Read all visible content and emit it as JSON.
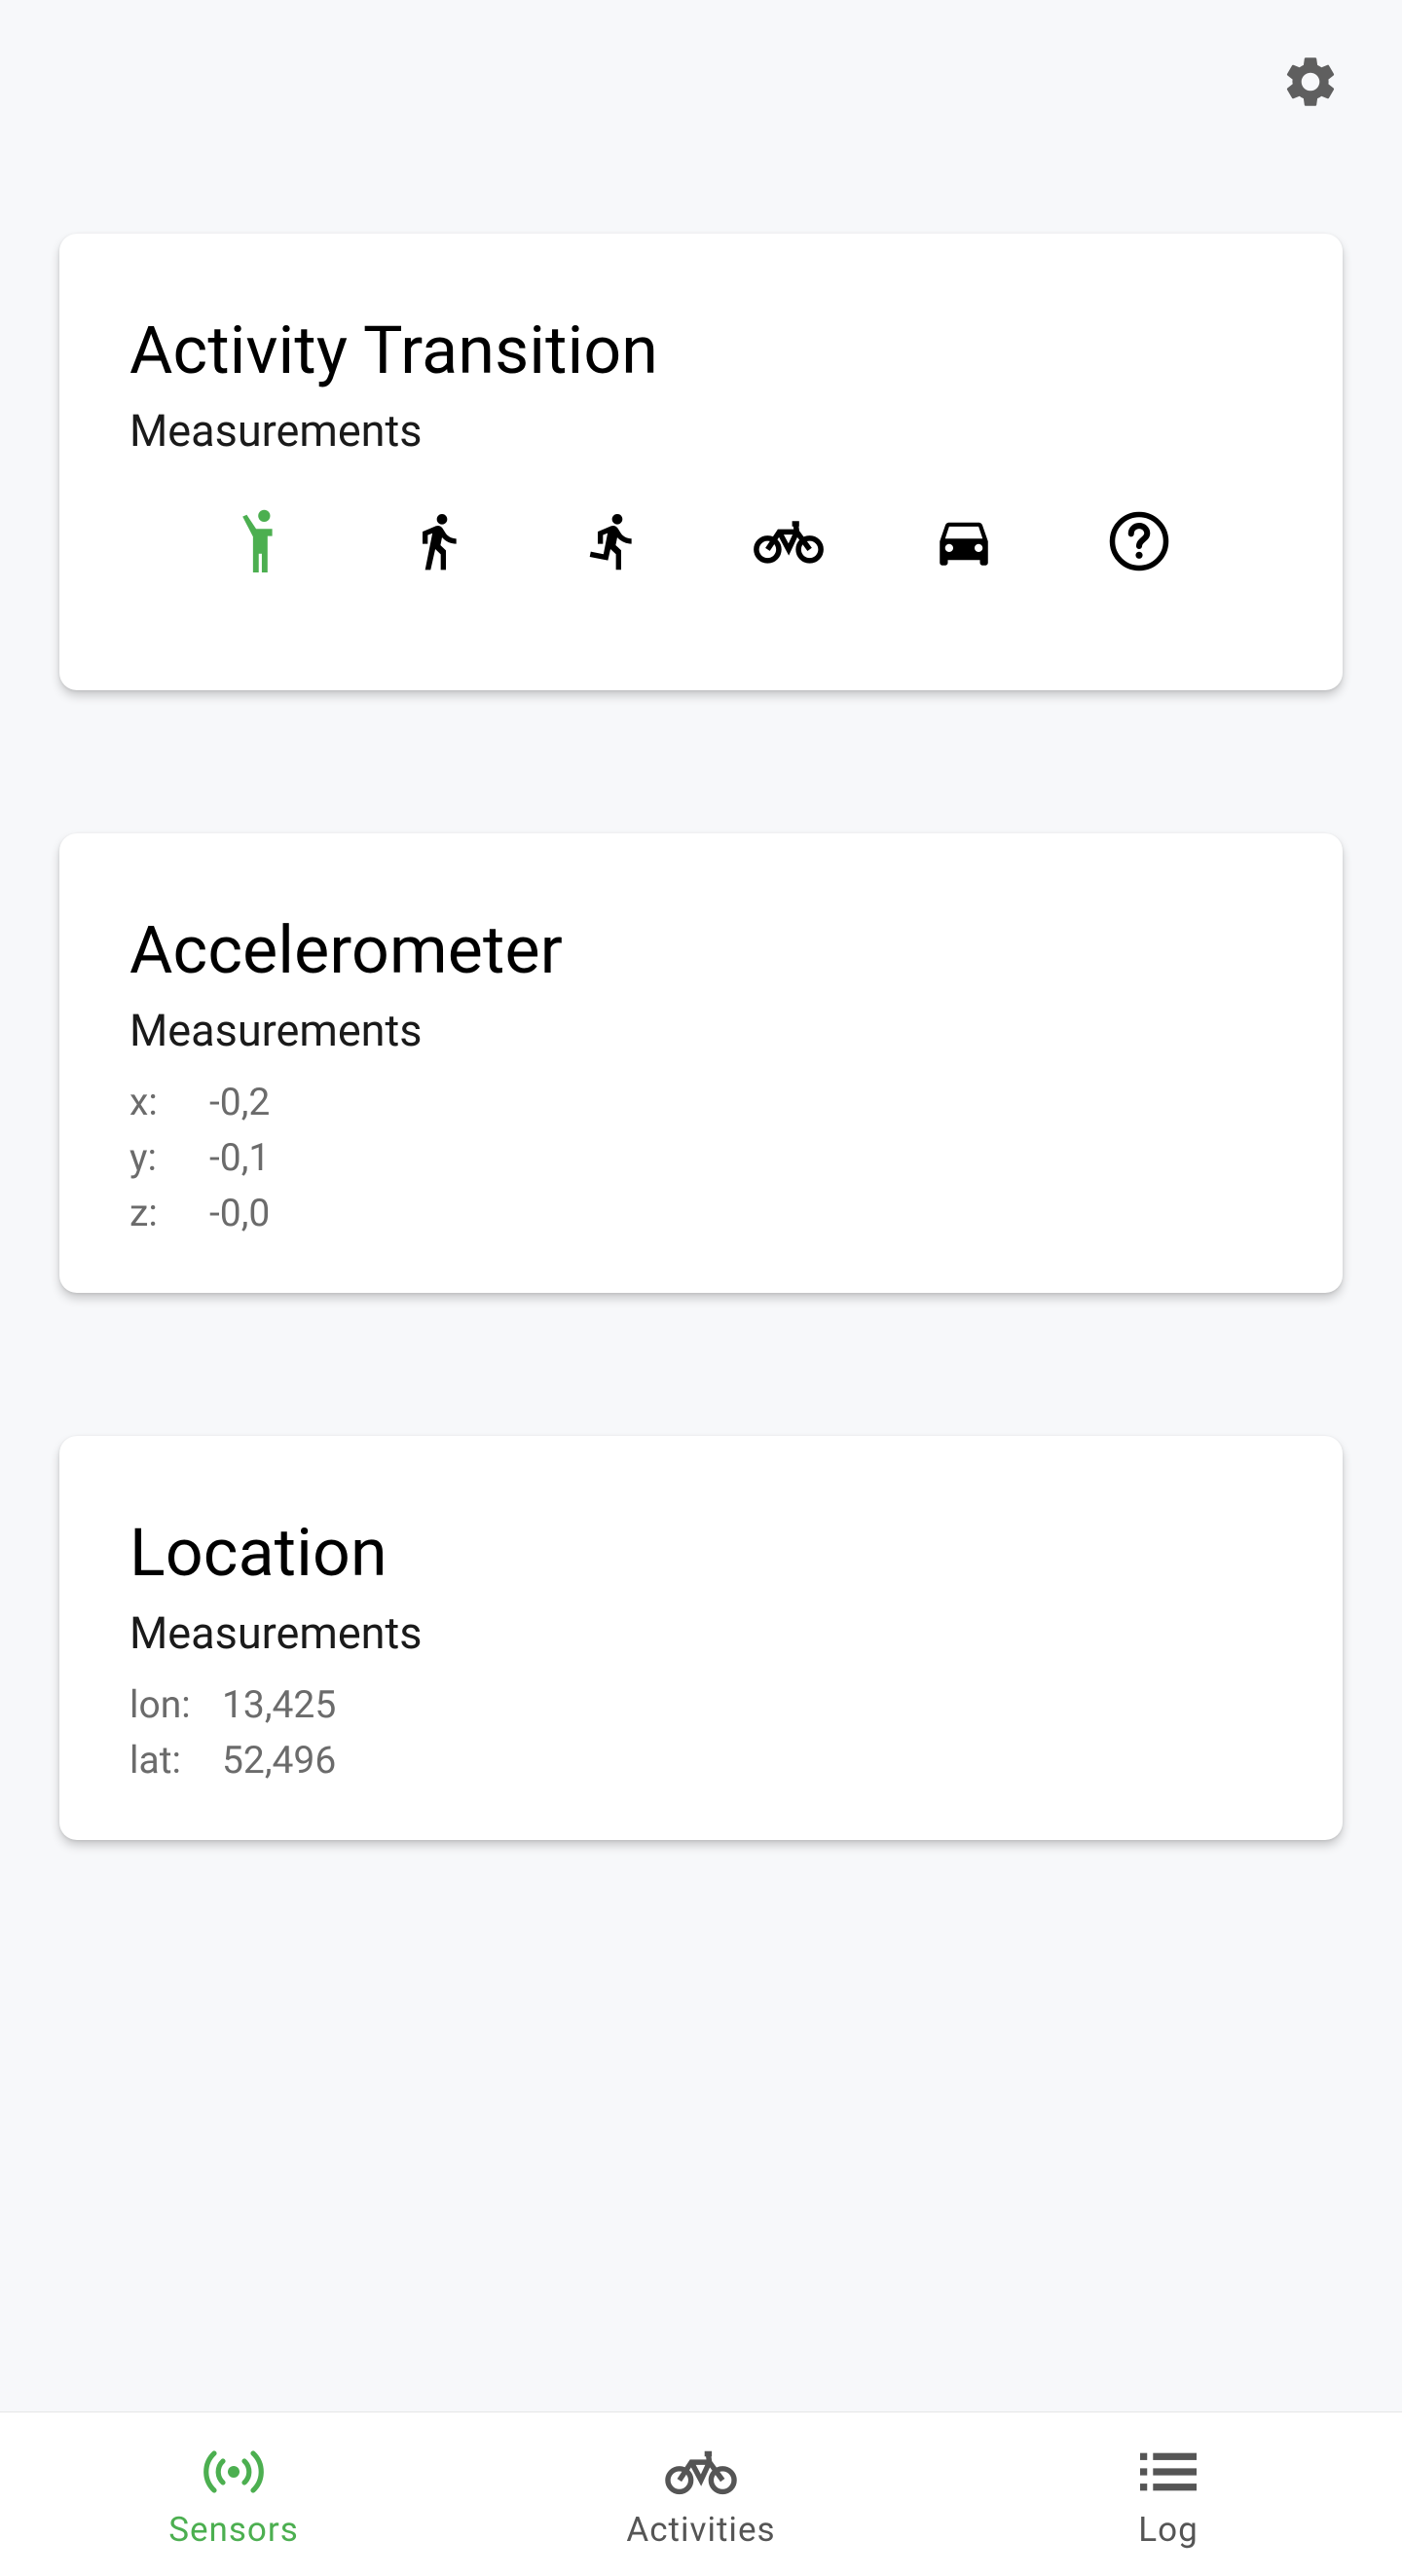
{
  "colors": {
    "accent": "#4caf50",
    "icon_default": "#000000",
    "nav_inactive": "#555555",
    "value_text": "#6b6b6b"
  },
  "header": {
    "settings_icon": "gear-icon"
  },
  "activity_card": {
    "title": "Activity Transition",
    "subtitle": "Measurements",
    "icons": [
      {
        "name": "still-icon",
        "active": true
      },
      {
        "name": "walking-icon",
        "active": false
      },
      {
        "name": "running-icon",
        "active": false
      },
      {
        "name": "bicycle-icon",
        "active": false
      },
      {
        "name": "car-icon",
        "active": false
      },
      {
        "name": "unknown-icon",
        "active": false
      }
    ]
  },
  "accelerometer_card": {
    "title": "Accelerometer",
    "subtitle": "Measurements",
    "rows": [
      {
        "label": "x:",
        "value": "-0,2"
      },
      {
        "label": "y:",
        "value": "-0,1"
      },
      {
        "label": "z:",
        "value": "-0,0"
      }
    ]
  },
  "location_card": {
    "title": "Location",
    "subtitle": "Measurements",
    "rows": [
      {
        "label": "lon:",
        "value": "13,425"
      },
      {
        "label": "lat:",
        "value": "52,496"
      }
    ]
  },
  "bottom_nav": {
    "items": [
      {
        "label": "Sensors",
        "icon": "sensors-icon",
        "active": true
      },
      {
        "label": "Activities",
        "icon": "bicycle-icon",
        "active": false
      },
      {
        "label": "Log",
        "icon": "list-icon",
        "active": false
      }
    ]
  }
}
